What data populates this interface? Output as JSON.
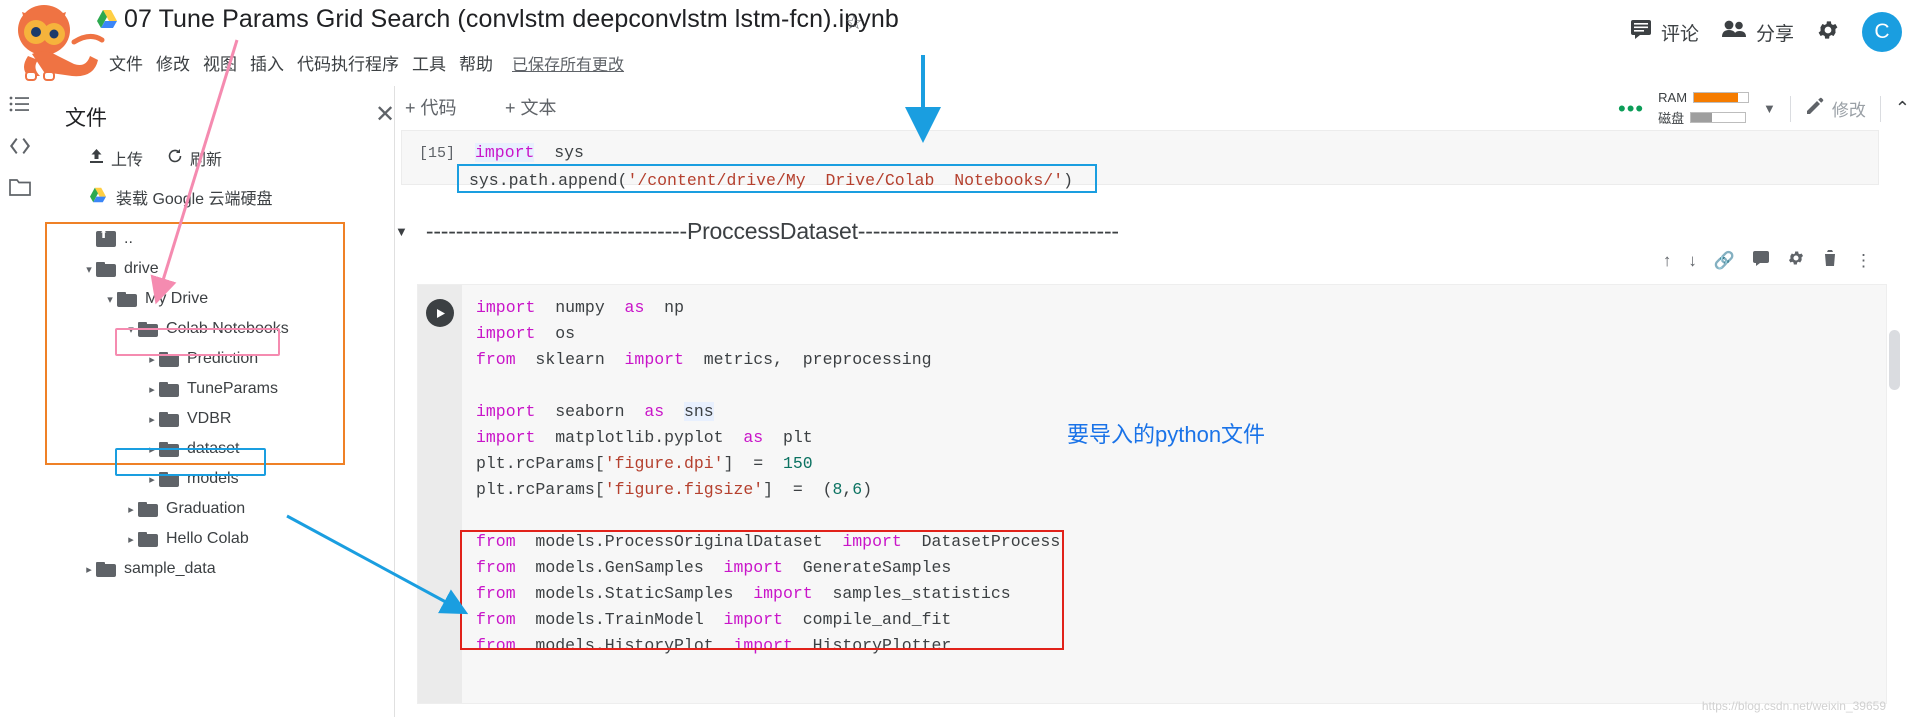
{
  "header": {
    "drive_icon": "drive-triangle-icon",
    "title": "07 Tune Params Grid Search (convlstm deepconvlstm lstm-fcn).ipynb",
    "star_icon": "☆",
    "menus": [
      "文件",
      "修改",
      "视图",
      "插入",
      "代码执行程序",
      "工具",
      "帮助"
    ],
    "saved_status": "已保存所有更改",
    "comment_label": "评论",
    "share_label": "分享",
    "settings_icon": "gear-icon",
    "avatar_letter": "C"
  },
  "toolbar": {
    "add_code": "+ 代码",
    "add_text": "+ 文本",
    "ram_label": "RAM",
    "disk_label": "磁盘",
    "ram_fill_pct": 82,
    "disk_fill_pct": 38,
    "ram_color": "#f57c00",
    "disk_color": "#9e9e9e",
    "edit_label": "修改",
    "caret_down": "▼",
    "chevron_up": "⌃"
  },
  "rail": {
    "items": [
      "list-icon",
      "code-brackets-icon",
      "folder-icon"
    ]
  },
  "files_panel": {
    "title": "文件",
    "close_icon": "✕",
    "upload_label": "上传",
    "refresh_label": "刷新",
    "mount_drive_label": "装载 Google 云端硬盘",
    "tree": [
      {
        "label": "..",
        "depth": 1,
        "arrow": "",
        "icon": "folder-up-icon"
      },
      {
        "label": "drive",
        "depth": 1,
        "arrow": "▾",
        "icon": "folder-icon"
      },
      {
        "label": "My Drive",
        "depth": 2,
        "arrow": "▾",
        "icon": "folder-icon"
      },
      {
        "label": "Colab Notebooks",
        "depth": 3,
        "arrow": "▾",
        "icon": "folder-icon"
      },
      {
        "label": "Prediction",
        "depth": 4,
        "arrow": "▸",
        "icon": "folder-icon"
      },
      {
        "label": "TuneParams",
        "depth": 4,
        "arrow": "▸",
        "icon": "folder-icon"
      },
      {
        "label": "VDBR",
        "depth": 4,
        "arrow": "▸",
        "icon": "folder-icon"
      },
      {
        "label": "dataset",
        "depth": 4,
        "arrow": "▸",
        "icon": "folder-icon"
      },
      {
        "label": "models",
        "depth": 4,
        "arrow": "▸",
        "icon": "folder-icon"
      },
      {
        "label": "Graduation",
        "depth": 3,
        "arrow": "▸",
        "icon": "folder-icon"
      },
      {
        "label": "Hello Colab",
        "depth": 3,
        "arrow": "▸",
        "icon": "folder-icon"
      },
      {
        "label": "sample_data",
        "depth": 1,
        "arrow": "▸",
        "icon": "folder-icon"
      }
    ]
  },
  "notebook": {
    "cell1": {
      "prompt": "[15]",
      "line1_kw": "import",
      "line1_rest": "  sys",
      "line2_obj": "sys.path.append(",
      "line2_str": "'/content/drive/My  Drive/Colab  Notebooks/'",
      "line2_end": ")"
    },
    "markdown_heading": "-----------------------------------ProccessDataset-----------------------------------",
    "cell2_lines": [
      {
        "segs": [
          {
            "t": "import",
            "c": "kw"
          },
          {
            "t": "  numpy  ",
            "c": ""
          },
          {
            "t": "as",
            "c": "kw"
          },
          {
            "t": "  np",
            "c": ""
          }
        ]
      },
      {
        "segs": [
          {
            "t": "import",
            "c": "kw"
          },
          {
            "t": "  os",
            "c": ""
          }
        ]
      },
      {
        "segs": [
          {
            "t": "from",
            "c": "kw"
          },
          {
            "t": "  sklearn  ",
            "c": ""
          },
          {
            "t": "import",
            "c": "kw"
          },
          {
            "t": "  metrics,  preprocessing",
            "c": ""
          }
        ]
      },
      {
        "segs": [
          {
            "t": "",
            "c": ""
          }
        ]
      },
      {
        "segs": [
          {
            "t": "import",
            "c": "kw"
          },
          {
            "t": "  seaborn  ",
            "c": ""
          },
          {
            "t": "as",
            "c": "kw"
          },
          {
            "t": "  ",
            "c": ""
          },
          {
            "t": "sns",
            "c": "var-hl"
          }
        ]
      },
      {
        "segs": [
          {
            "t": "import",
            "c": "kw"
          },
          {
            "t": "  matplotlib.pyplot  ",
            "c": ""
          },
          {
            "t": "as",
            "c": "kw"
          },
          {
            "t": "  plt",
            "c": ""
          }
        ]
      },
      {
        "segs": [
          {
            "t": "plt.rcParams[",
            "c": ""
          },
          {
            "t": "'figure.dpi'",
            "c": "str"
          },
          {
            "t": "]  =  ",
            "c": ""
          },
          {
            "t": "150",
            "c": "num"
          }
        ]
      },
      {
        "segs": [
          {
            "t": "plt.rcParams[",
            "c": ""
          },
          {
            "t": "'figure.figsize'",
            "c": "str"
          },
          {
            "t": "]  =  (",
            "c": ""
          },
          {
            "t": "8",
            "c": "num"
          },
          {
            "t": ",",
            "c": ""
          },
          {
            "t": "6",
            "c": "num"
          },
          {
            "t": ")",
            "c": ""
          }
        ]
      },
      {
        "segs": [
          {
            "t": "",
            "c": ""
          }
        ]
      },
      {
        "segs": [
          {
            "t": "from",
            "c": "kw"
          },
          {
            "t": "  models.ProcessOriginalDataset  ",
            "c": ""
          },
          {
            "t": "import",
            "c": "kw"
          },
          {
            "t": "  DatasetProcess",
            "c": ""
          }
        ]
      },
      {
        "segs": [
          {
            "t": "from",
            "c": "kw"
          },
          {
            "t": "  models.GenSamples  ",
            "c": ""
          },
          {
            "t": "import",
            "c": "kw"
          },
          {
            "t": "  GenerateSamples",
            "c": ""
          }
        ]
      },
      {
        "segs": [
          {
            "t": "from",
            "c": "kw"
          },
          {
            "t": "  models.StaticSamples  ",
            "c": ""
          },
          {
            "t": "import",
            "c": "kw"
          },
          {
            "t": "  samples_statistics",
            "c": ""
          }
        ]
      },
      {
        "segs": [
          {
            "t": "from",
            "c": "kw"
          },
          {
            "t": "  models.TrainModel  ",
            "c": ""
          },
          {
            "t": "import",
            "c": "kw"
          },
          {
            "t": "  compile_and_fit",
            "c": ""
          }
        ]
      },
      {
        "segs": [
          {
            "t": "from",
            "c": "kw"
          },
          {
            "t": "  models.HistoryPlot  ",
            "c": ""
          },
          {
            "t": "import",
            "c": "kw"
          },
          {
            "t": "  HistoryPlotter",
            "c": ""
          }
        ]
      }
    ],
    "cell_tools": [
      "move-up-icon",
      "move-down-icon",
      "link-icon",
      "comment-icon",
      "settings-icon",
      "delete-icon",
      "more-vert-icon"
    ]
  },
  "annotations": {
    "blue_note": "要导入的python文件",
    "orange_box_color": "#ef8126",
    "pink_box_color": "#f58bb0",
    "blue_box_color": "#1a9ee0",
    "red_box_color": "#e1221a"
  },
  "watermark": "https://blog.csdn.net/weixin_39659"
}
